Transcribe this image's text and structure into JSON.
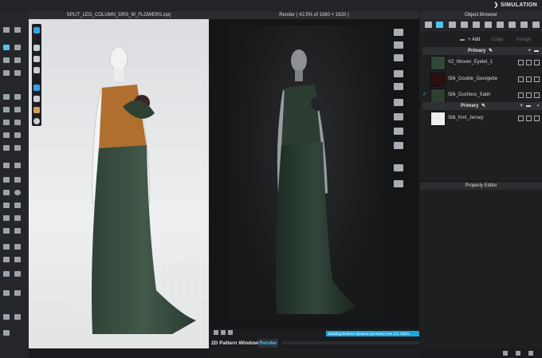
{
  "app": {
    "mode_label": "SIMULATION"
  },
  "view3d": {
    "title": "SPLIT_LEG_COLUMN_DRS_W_FLOWERS.zprj"
  },
  "render_window": {
    "title": "Render ( 42.5% of 1080 × 1920 )",
    "progress_text": "Building Embree dynamic geometry tree 1/1, 100%",
    "tab_2d": "2D Pattern Window",
    "tab_render": "Render"
  },
  "object_browser": {
    "title": "Object Browser",
    "add_label": "Add",
    "copy_label": "Copy",
    "assign_label": "Assign",
    "section_primary_1": "Primary",
    "section_primary_2": "Primary",
    "fabrics": [
      {
        "name": "V2_Woven_Eyelet_1",
        "color": "#33463a",
        "checked": false
      },
      {
        "name": "Silk_Double_Georgette",
        "color": "#2a1013",
        "checked": false
      },
      {
        "name": "Silk_Duchess_Satin",
        "color": "#2d3f33",
        "checked": true
      }
    ],
    "fabrics_2": [
      {
        "name": "Silk_Knit_Jersey",
        "color": "#eeeeea",
        "checked": false
      }
    ]
  },
  "property_editor": {
    "title": "Property Editor"
  },
  "icons": {
    "mode": "simulation-icon",
    "add": "plus-icon",
    "edit": "pencil-icon",
    "folder": "folder-icon"
  }
}
